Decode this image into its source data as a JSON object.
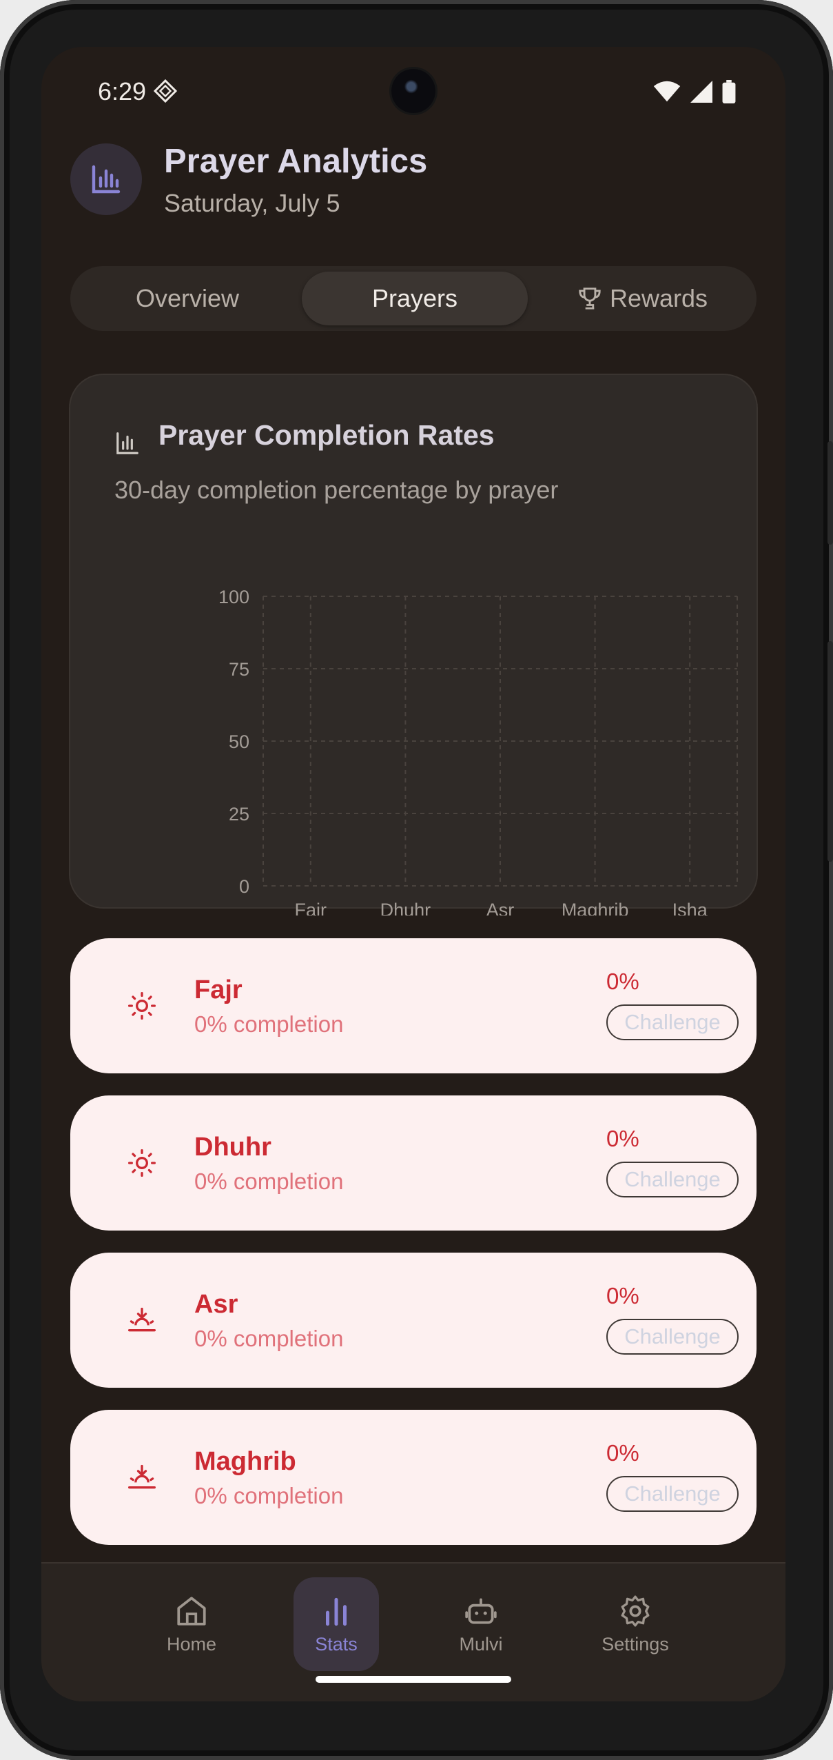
{
  "status_bar": {
    "time": "6:29"
  },
  "header": {
    "title": "Prayer Analytics",
    "date": "Saturday, July 5",
    "icon": "bar-chart-icon"
  },
  "tabs": [
    {
      "label": "Overview",
      "active": false
    },
    {
      "label": "Prayers",
      "active": true
    },
    {
      "label": "Rewards",
      "active": false,
      "icon": "trophy-icon"
    }
  ],
  "chart_card": {
    "title": "Prayer Completion Rates",
    "subtitle": "30-day completion percentage by prayer"
  },
  "chart_data": {
    "type": "bar",
    "title": "Prayer Completion Rates",
    "subtitle": "30-day completion percentage by prayer",
    "categories": [
      "Fajr",
      "Dhuhr",
      "Asr",
      "Maghrib",
      "Isha"
    ],
    "values": [
      0,
      0,
      0,
      0,
      0
    ],
    "yticks": [
      "0",
      "25",
      "50",
      "75",
      "100"
    ],
    "ylim": [
      0,
      100
    ],
    "grid": true,
    "xlabel": "",
    "ylabel": ""
  },
  "prayers": [
    {
      "name": "Fajr",
      "completion": "0% completion",
      "percent": "0%",
      "button": "Challenge",
      "icon": "sun-icon"
    },
    {
      "name": "Dhuhr",
      "completion": "0% completion",
      "percent": "0%",
      "button": "Challenge",
      "icon": "sun-icon"
    },
    {
      "name": "Asr",
      "completion": "0% completion",
      "percent": "0%",
      "button": "Challenge",
      "icon": "sunset-icon"
    },
    {
      "name": "Maghrib",
      "completion": "0% completion",
      "percent": "0%",
      "button": "Challenge",
      "icon": "sunset-icon"
    }
  ],
  "nav": [
    {
      "label": "Home",
      "icon": "home-icon",
      "active": false
    },
    {
      "label": "Stats",
      "icon": "bar-chart-icon",
      "active": true
    },
    {
      "label": "Mulvi",
      "icon": "robot-icon",
      "active": false
    },
    {
      "label": "Settings",
      "icon": "gear-icon",
      "active": false
    }
  ],
  "colors": {
    "background": "#231c18",
    "accent": "#8a84d6",
    "prayer_text": "#cc2a33",
    "prayer_card": "#fdf0f0"
  }
}
